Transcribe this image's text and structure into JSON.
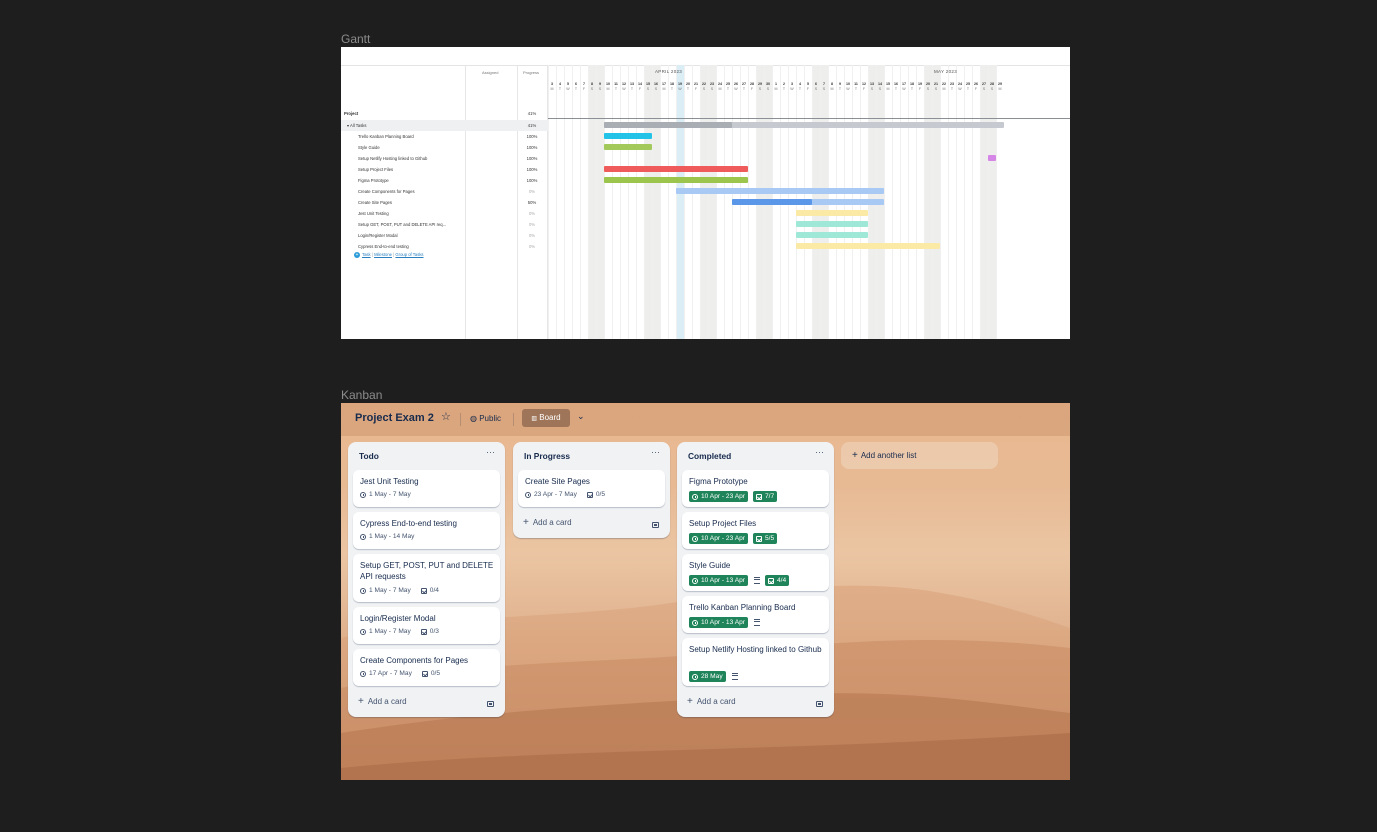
{
  "frames": {
    "gantt_label": "Gantt",
    "kanban_label": "Kanban"
  },
  "gantt": {
    "columns": {
      "assigned": "Assigned",
      "progress": "Progress"
    },
    "months": [
      "APRIL 2023",
      "MAY 2023"
    ],
    "days": [
      {
        "n": "3",
        "d": "M"
      },
      {
        "n": "4",
        "d": "T"
      },
      {
        "n": "5",
        "d": "W"
      },
      {
        "n": "6",
        "d": "T"
      },
      {
        "n": "7",
        "d": "F"
      },
      {
        "n": "8",
        "d": "S",
        "we": true
      },
      {
        "n": "9",
        "d": "S",
        "we": true
      },
      {
        "n": "10",
        "d": "M"
      },
      {
        "n": "11",
        "d": "T"
      },
      {
        "n": "12",
        "d": "W"
      },
      {
        "n": "13",
        "d": "T"
      },
      {
        "n": "14",
        "d": "F"
      },
      {
        "n": "15",
        "d": "S",
        "we": true
      },
      {
        "n": "16",
        "d": "S",
        "we": true
      },
      {
        "n": "17",
        "d": "M"
      },
      {
        "n": "18",
        "d": "T"
      },
      {
        "n": "19",
        "d": "W",
        "today": true
      },
      {
        "n": "20",
        "d": "T"
      },
      {
        "n": "21",
        "d": "F"
      },
      {
        "n": "22",
        "d": "S",
        "we": true
      },
      {
        "n": "23",
        "d": "S",
        "we": true
      },
      {
        "n": "24",
        "d": "M"
      },
      {
        "n": "25",
        "d": "T"
      },
      {
        "n": "26",
        "d": "W"
      },
      {
        "n": "27",
        "d": "T"
      },
      {
        "n": "28",
        "d": "F"
      },
      {
        "n": "29",
        "d": "S",
        "we": true
      },
      {
        "n": "30",
        "d": "S",
        "we": true
      },
      {
        "n": "1",
        "d": "M"
      },
      {
        "n": "2",
        "d": "T"
      },
      {
        "n": "3",
        "d": "W"
      },
      {
        "n": "4",
        "d": "T"
      },
      {
        "n": "5",
        "d": "F"
      },
      {
        "n": "6",
        "d": "S",
        "we": true
      },
      {
        "n": "7",
        "d": "S",
        "we": true
      },
      {
        "n": "8",
        "d": "M"
      },
      {
        "n": "9",
        "d": "T"
      },
      {
        "n": "10",
        "d": "W"
      },
      {
        "n": "11",
        "d": "T"
      },
      {
        "n": "12",
        "d": "F"
      },
      {
        "n": "13",
        "d": "S",
        "we": true
      },
      {
        "n": "14",
        "d": "S",
        "we": true
      },
      {
        "n": "15",
        "d": "M"
      },
      {
        "n": "16",
        "d": "T"
      },
      {
        "n": "17",
        "d": "W"
      },
      {
        "n": "18",
        "d": "T"
      },
      {
        "n": "19",
        "d": "F"
      },
      {
        "n": "20",
        "d": "S",
        "we": true
      },
      {
        "n": "21",
        "d": "S",
        "we": true
      },
      {
        "n": "22",
        "d": "M"
      },
      {
        "n": "23",
        "d": "T"
      },
      {
        "n": "24",
        "d": "W"
      },
      {
        "n": "25",
        "d": "T"
      },
      {
        "n": "26",
        "d": "F"
      },
      {
        "n": "27",
        "d": "S",
        "we": true
      },
      {
        "n": "28",
        "d": "S",
        "we": true
      },
      {
        "n": "29",
        "d": "M"
      }
    ],
    "project": {
      "name": "Project",
      "progress": "41%"
    },
    "group": {
      "name": "▾ All Tasks",
      "progress": "41%",
      "start": "10 Apr",
      "end": "29 May",
      "done_until": "25 Apr"
    },
    "tasks": [
      {
        "name": "Trello Kanban Planning Board",
        "progress": "100%",
        "start": "10 Apr",
        "end": "15 Apr",
        "color": "#22c3e6"
      },
      {
        "name": "Style Guide",
        "progress": "100%",
        "start": "10 Apr",
        "end": "15 Apr",
        "color": "#a2c95a"
      },
      {
        "name": "Setup Netlify Hosting linked to Github",
        "progress": "100%",
        "start": "28 May",
        "end": "28 May",
        "color": "#d686e6"
      },
      {
        "name": "Setup Project Files",
        "progress": "100%",
        "start": "10 Apr",
        "end": "27 Apr",
        "color": "#ef5a5a"
      },
      {
        "name": "Figma Prototype",
        "progress": "100%",
        "start": "10 Apr",
        "end": "27 Apr",
        "color": "#9cc54e"
      },
      {
        "name": "Create Components for Pages",
        "progress": "0%",
        "start": "19 Apr",
        "end": "14 May",
        "color": "#a9c9f5"
      },
      {
        "name": "Create Site Pages",
        "progress": "50%",
        "start": "26 Apr",
        "end": "14 May",
        "color": "#a9c9f5",
        "done_until": "5 May",
        "done_color": "#5a97e8"
      },
      {
        "name": "Jest Unit Testing",
        "progress": "0%",
        "start": "4 May",
        "end": "12 May",
        "color": "#fbe9a6"
      },
      {
        "name": "Setup GET, POST, PUT and DELETE API req...",
        "progress": "0%",
        "start": "4 May",
        "end": "12 May",
        "color": "#9fe8d7"
      },
      {
        "name": "Login/Register Modal",
        "progress": "0%",
        "start": "4 May",
        "end": "12 May",
        "color": "#9fe8d7"
      },
      {
        "name": "Cypress End-to-end testing",
        "progress": "0%",
        "start": "4 May",
        "end": "21 May",
        "color": "#fbe9a6"
      }
    ],
    "add_links": {
      "task": "Task",
      "milestone": "Milestone",
      "group": "Group of Tasks"
    }
  },
  "kanban": {
    "title": "Project Exam 2",
    "visibility": "Public",
    "view": "Board",
    "add_card": "Add a card",
    "add_list": "Add another list",
    "lists": [
      {
        "title": "Todo",
        "cards": [
          {
            "title": "Jest Unit Testing",
            "dates": "1 May - 7 May"
          },
          {
            "title": "Cypress End-to-end testing",
            "dates": "1 May - 14 May"
          },
          {
            "title": "Setup GET, POST, PUT and DELETE API requests",
            "dates": "1 May - 7 May",
            "checklist": "0/4"
          },
          {
            "title": "Login/Register Modal",
            "dates": "1 May - 7 May",
            "checklist": "0/3"
          },
          {
            "title": "Create Components for Pages",
            "dates": "17 Apr - 7 May",
            "checklist": "0/5"
          }
        ]
      },
      {
        "title": "In Progress",
        "cards": [
          {
            "title": "Create Site Pages",
            "dates": "23 Apr - 7 May",
            "checklist": "0/5"
          }
        ]
      },
      {
        "title": "Completed",
        "cards": [
          {
            "title": "Figma Prototype",
            "dates": "10 Apr - 23 Apr",
            "checklist": "7/7",
            "complete": true
          },
          {
            "title": "Setup Project Files",
            "dates": "10 Apr - 23 Apr",
            "checklist": "5/5",
            "complete": true
          },
          {
            "title": "Style Guide",
            "dates": "10 Apr - 13 Apr",
            "description": true,
            "checklist": "4/4",
            "complete": true
          },
          {
            "title": "Trello Kanban Planning Board",
            "dates": "10 Apr - 13 Apr",
            "description": true,
            "complete": true
          },
          {
            "title": "Setup Netlify Hosting linked to Github",
            "dates": "28 May",
            "description": true,
            "complete": true
          }
        ]
      }
    ],
    "colors": {
      "complete_badge": "#1f845a",
      "text": "#172b4d",
      "list_bg": "#f1f2f4"
    }
  }
}
